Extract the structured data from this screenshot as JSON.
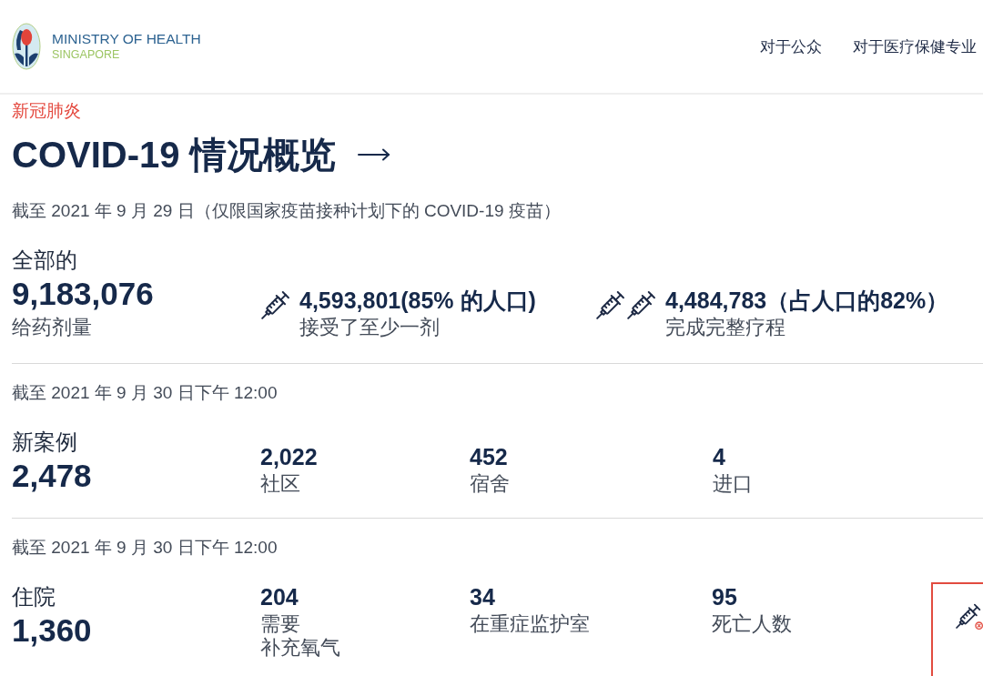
{
  "header": {
    "logo": {
      "title": "MINISTRY OF HEALTH",
      "subtitle": "SINGAPORE"
    },
    "nav": [
      {
        "label": "对于公众"
      },
      {
        "label": "对于医疗保健专业"
      }
    ]
  },
  "page": {
    "category": "新冠肺炎",
    "title": "COVID-19 情况概览"
  },
  "sections": [
    {
      "kind": "vaccination",
      "as_of": "截至 2021 年 9 月 29 日（仅限国家疫苗接种计划下的 COVID-19 疫苗）",
      "total": {
        "label": "全部的",
        "value": "9,183,076",
        "caption": "给药剂量"
      },
      "stats": [
        {
          "kind": "partial",
          "value": "4,593,801(85% 的人口)",
          "caption": "接受了至少一剂"
        },
        {
          "kind": "complete",
          "value": "4,484,783（占人口的82%）",
          "caption": "完成完整疗程"
        }
      ]
    },
    {
      "kind": "cases",
      "as_of": "截至 2021 年 9 月 30 日下午 12:00",
      "total": {
        "label": "新案例",
        "value": "2,478"
      },
      "breakdown": [
        {
          "value": "2,022",
          "label_lines": [
            "社区"
          ]
        },
        {
          "value": "452",
          "label_lines": [
            "宿舍"
          ]
        },
        {
          "value": "4",
          "label_lines": [
            "进口"
          ]
        }
      ]
    },
    {
      "kind": "hospital",
      "as_of": "截至 2021 年 9 月 30 日下午 12:00",
      "total": {
        "label": "住院",
        "value": "1,360"
      },
      "breakdown": [
        {
          "value": "204",
          "label_lines": [
            "需要",
            "补充氧气"
          ]
        },
        {
          "value": "34",
          "label_lines": [
            "在重症监护室"
          ]
        },
        {
          "value": "95",
          "label_lines": [
            "死亡人数"
          ]
        }
      ]
    }
  ]
}
